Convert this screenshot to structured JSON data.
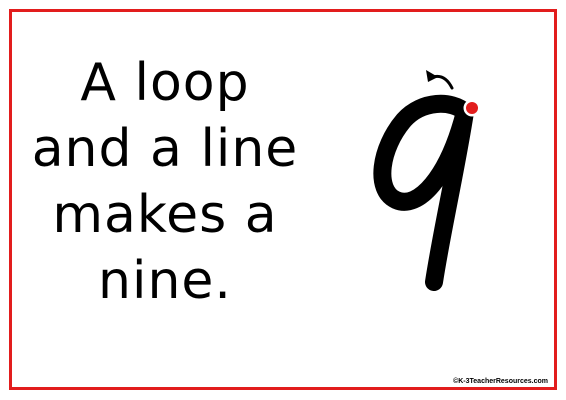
{
  "card": {
    "border_color": "#e21d1d",
    "background": "#ffffff"
  },
  "rhyme": {
    "lines": [
      "A loop",
      "and a line",
      "makes a",
      "nine."
    ]
  },
  "numeral": {
    "glyph": "9",
    "stroke_color": "#000000",
    "start_dot_color": "#e21d1d",
    "direction_arrow_icon": "curved-arrow-left-icon"
  },
  "footer": {
    "copyright": "©K-3TeacherResources.com"
  }
}
